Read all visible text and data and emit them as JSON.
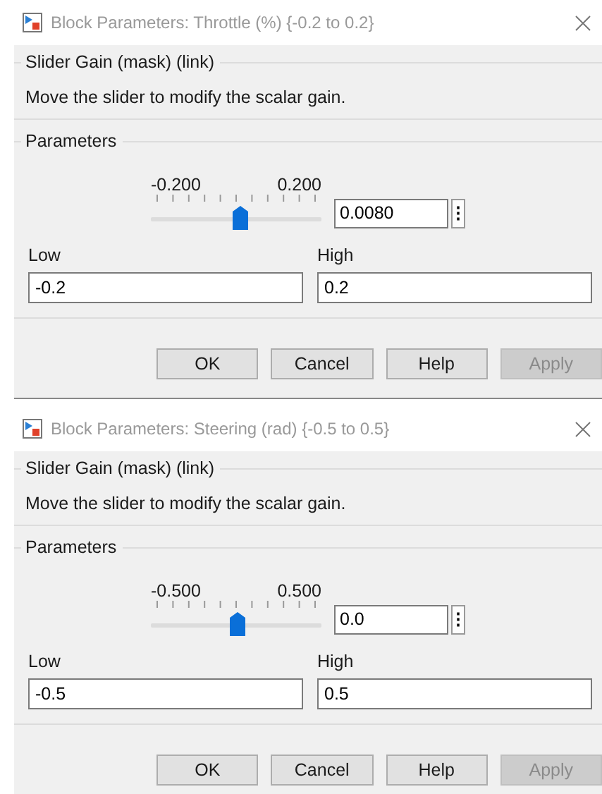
{
  "dialogs": [
    {
      "title": "Block Parameters: Throttle (%) {-0.2 to 0.2}",
      "group_title": "Slider Gain (mask) (link)",
      "description": "Move the slider to modify the scalar gain.",
      "section": "Parameters",
      "slider": {
        "min_label": "-0.200",
        "max_label": "0.200",
        "level": 0.52
      },
      "value": "0.0080",
      "menu_glyph": "⋮",
      "low": {
        "label": "Low",
        "value": "-0.2"
      },
      "high": {
        "label": "High",
        "value": "0.2"
      },
      "buttons": [
        {
          "label": "OK",
          "disabled": false
        },
        {
          "label": "Cancel",
          "disabled": false
        },
        {
          "label": "Help",
          "disabled": false
        },
        {
          "label": "Apply",
          "disabled": true
        }
      ]
    },
    {
      "title": "Block Parameters: Steering (rad) {-0.5 to 0.5}",
      "group_title": "Slider Gain (mask) (link)",
      "description": "Move the slider to modify the scalar gain.",
      "section": "Parameters",
      "slider": {
        "min_label": "-0.500",
        "max_label": "0.500",
        "level": 0.5
      },
      "value": "0.0",
      "menu_glyph": "⋮",
      "low": {
        "label": "Low",
        "value": "-0.5"
      },
      "high": {
        "label": "High",
        "value": "0.5"
      },
      "buttons": [
        {
          "label": "OK",
          "disabled": false
        },
        {
          "label": "Cancel",
          "disabled": false
        },
        {
          "label": "Help",
          "disabled": false
        },
        {
          "label": "Apply",
          "disabled": true
        }
      ]
    }
  ]
}
